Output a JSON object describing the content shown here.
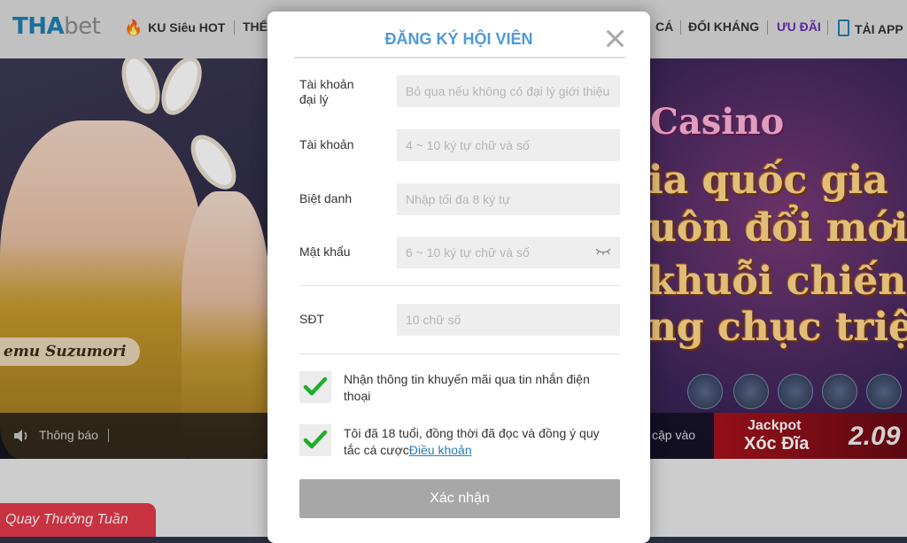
{
  "nav": {
    "logo_a": "THA",
    "logo_b": "bet",
    "items": [
      {
        "label": "KU Siêu HOT"
      },
      {
        "label": "THỂ"
      },
      {
        "label": "CÁ"
      },
      {
        "label": "ĐỐI KHÁNG"
      },
      {
        "label": "ƯU ĐÃI"
      },
      {
        "label": "TẢI APP"
      }
    ]
  },
  "hero": {
    "name_tag": "emu Suzumori",
    "title": "Casino",
    "lines": [
      "ia quốc gia",
      "uôn đổi mới",
      "khuỗi chiến th",
      "ng chục triệu"
    ],
    "ticker_label": "Thông báo",
    "ticker_right": "cập vào",
    "jackpot_line1": "Jackpot",
    "jackpot_line2": "Xóc Đĩa",
    "jackpot_value": "2.09"
  },
  "lower": {
    "badge": "Quay Thưởng Tuần"
  },
  "modal": {
    "title": "ĐĂNG KÝ HỘI VIÊN",
    "fields": [
      {
        "label": "Tài khoản đại lý",
        "placeholder": "Bỏ qua nếu không có đại lý giới thiệu",
        "value": ""
      },
      {
        "label": "Tài khoản",
        "placeholder": "4 ~ 10 ký tự chữ và số",
        "value": ""
      },
      {
        "label": "Biệt danh",
        "placeholder": "Nhập tối đa 8 ký tự",
        "value": ""
      },
      {
        "label": "Mật khẩu",
        "placeholder": "6 ~ 10 ký tự chữ và số",
        "value": ""
      },
      {
        "label": "SĐT",
        "placeholder": "10 chữ số",
        "value": ""
      }
    ],
    "checkboxes": [
      {
        "text": "Nhận thông tin khuyến mãi qua tin nhắn điện thoại",
        "checked": true
      },
      {
        "text": "Tôi đã 18 tuổi, đồng thời đã đọc và đồng ý quy tắc cá cược",
        "link": "Điều khoản",
        "checked": true
      }
    ],
    "submit_label": "Xác nhận",
    "colors": {
      "title": "#4f9ad6",
      "check": "#1fae2c",
      "submit_bg": "#a7a7a7"
    }
  }
}
